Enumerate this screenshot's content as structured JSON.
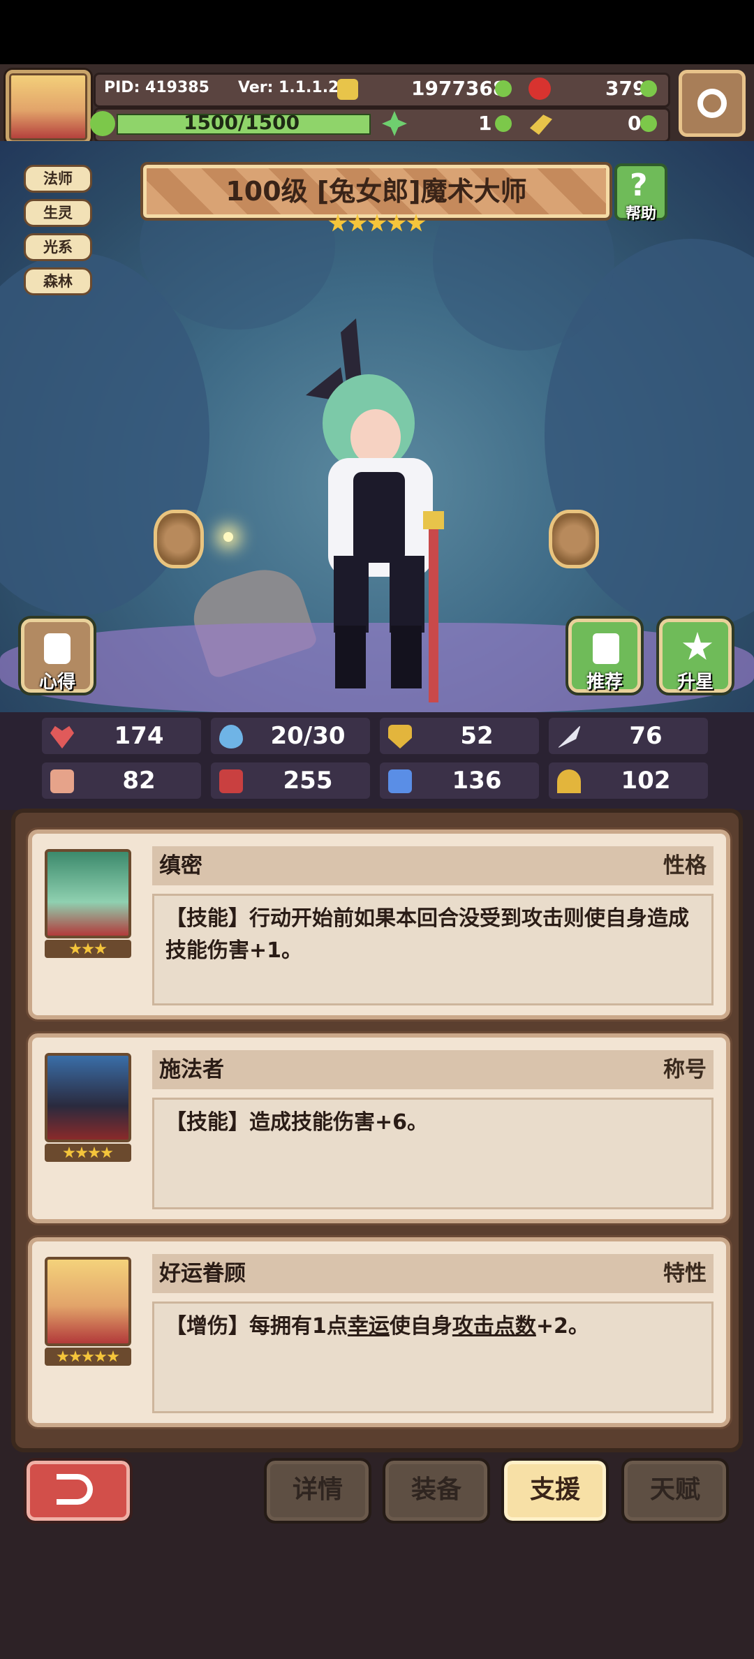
{
  "topbar": {
    "pid": "PID: 419385",
    "version": "Ver: 1.1.1.2",
    "gold": "1977368",
    "gems": "379",
    "stamina": "1500/1500",
    "clover": "1",
    "key": "0"
  },
  "hero": {
    "tags": [
      "法师",
      "生灵",
      "光系",
      "森林"
    ],
    "title": "100级 [兔女郎]魔术大师",
    "stars": 5,
    "help_label": "帮助",
    "insight_label": "心得",
    "recommend_label": "推荐",
    "upgrade_label": "升星"
  },
  "stats": [
    {
      "icon": "heart-icon",
      "color": "#e05a5a",
      "value": "174"
    },
    {
      "icon": "water-drop-icon",
      "color": "#6fb4e6",
      "value": "20/30"
    },
    {
      "icon": "shield-icon",
      "color": "#e3b53c",
      "value": "52"
    },
    {
      "icon": "wing-icon",
      "color": "#e6e6f0",
      "value": "76"
    },
    {
      "icon": "fist-icon",
      "color": "#e6a38a",
      "value": "82"
    },
    {
      "icon": "book-icon",
      "color": "#c94040",
      "value": "255"
    },
    {
      "icon": "boot-icon",
      "color": "#5a8ee6",
      "value": "136"
    },
    {
      "icon": "horseshoe-icon",
      "color": "#e3b53c",
      "value": "102"
    }
  ],
  "cards": [
    {
      "name": "缜密",
      "type": "性格",
      "stars": 3,
      "desc": "【技能】行动开始前如果本回合没受到攻击则使自身造成技能伤害+1。"
    },
    {
      "name": "施法者",
      "type": "称号",
      "stars": 4,
      "desc": "【技能】造成技能伤害+6。"
    },
    {
      "name": "好运眷顾",
      "type": "特性",
      "stars": 5,
      "desc_parts": [
        "【增伤】每拥有1点",
        "幸运",
        "使自身",
        "攻击点数",
        "+2。"
      ]
    }
  ],
  "tabs": [
    {
      "label": "详情",
      "active": false
    },
    {
      "label": "装备",
      "active": false
    },
    {
      "label": "支援",
      "active": true
    },
    {
      "label": "天赋",
      "active": false
    }
  ]
}
